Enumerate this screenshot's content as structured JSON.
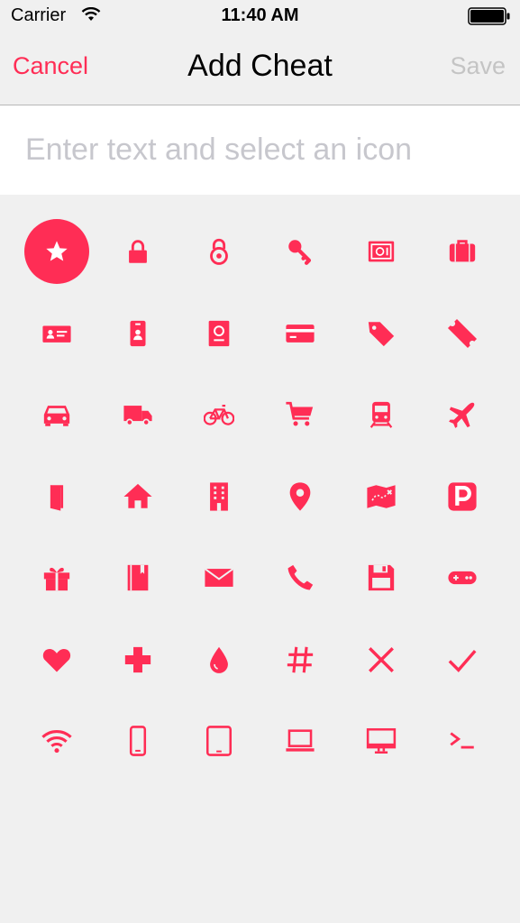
{
  "status_bar": {
    "carrier": "Carrier",
    "time": "11:40 AM"
  },
  "nav": {
    "cancel_label": "Cancel",
    "title": "Add Cheat",
    "save_label": "Save"
  },
  "input": {
    "placeholder": "Enter text and select an icon",
    "value": ""
  },
  "colors": {
    "accent": "#ff2d55",
    "disabled": "#c4c4c4",
    "placeholder": "#c7c7cd",
    "background": "#f0f0f0"
  },
  "selected_icon": "star-icon",
  "icons": [
    "star-icon",
    "lock-icon",
    "padlock-icon",
    "key-icon",
    "safe-icon",
    "briefcase-icon",
    "id-card-icon",
    "badge-icon",
    "passport-icon",
    "credit-card-icon",
    "tag-icon",
    "ticket-icon",
    "car-icon",
    "truck-icon",
    "bicycle-icon",
    "cart-icon",
    "train-icon",
    "airplane-icon",
    "door-icon",
    "home-icon",
    "building-icon",
    "location-pin-icon",
    "map-icon",
    "parking-icon",
    "gift-icon",
    "book-icon",
    "mail-icon",
    "phone-icon",
    "floppy-disk-icon",
    "gamepad-icon",
    "heart-icon",
    "medical-cross-icon",
    "drop-icon",
    "hash-icon",
    "x-icon",
    "checkmark-icon",
    "wifi-icon",
    "smartphone-icon",
    "tablet-icon",
    "laptop-icon",
    "desktop-icon",
    "terminal-icon"
  ]
}
